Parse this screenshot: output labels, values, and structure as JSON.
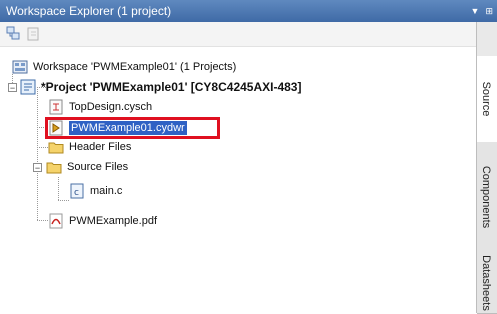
{
  "titlebar": {
    "title": "Workspace Explorer (1 project)"
  },
  "tree": {
    "workspace": "Workspace 'PWMExample01' (1 Projects)",
    "project": "*Project  'PWMExample01' [CY8C4245AXI-483]",
    "items": {
      "topdesign": "TopDesign.cysch",
      "cydwr": "PWMExample01.cydwr",
      "header_files": "Header Files",
      "source_files": "Source Files",
      "main_c": "main.c",
      "pdf": "PWMExample.pdf"
    }
  },
  "side_tabs": [
    "Source",
    "Components",
    "Datasheets"
  ],
  "colors": {
    "selection": "#2f61c4",
    "highlight_box": "#e01020",
    "titlebar": "#4a75b0"
  }
}
